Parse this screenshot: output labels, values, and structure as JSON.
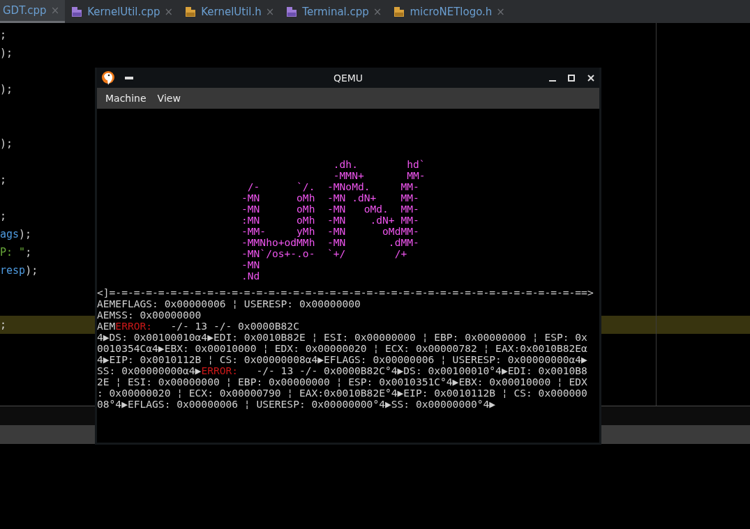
{
  "editor": {
    "tabs": [
      {
        "label": "GDT.cpp",
        "kind": "plain",
        "selected": true,
        "close": "×"
      },
      {
        "label": "KernelUtil.cpp",
        "kind": "cpp",
        "selected": false,
        "close": "×"
      },
      {
        "label": "KernelUtil.h",
        "kind": "h",
        "selected": false,
        "close": "×"
      },
      {
        "label": "Terminal.cpp",
        "kind": "cpp",
        "selected": false,
        "close": "×"
      },
      {
        "label": "microNETlogo.h",
        "kind": "h",
        "selected": false,
        "close": "×"
      }
    ],
    "code_lines": [
      {
        "kind": "code",
        "highlighted": false,
        "segments": [
          {
            "kind": "plain",
            "text": ";"
          }
        ]
      },
      {
        "kind": "code",
        "highlighted": false,
        "segments": [
          {
            "kind": "plain",
            "text": ");"
          }
        ]
      },
      {
        "kind": "blank",
        "highlighted": false
      },
      {
        "kind": "code",
        "highlighted": false,
        "segments": [
          {
            "kind": "plain",
            "text": ");"
          }
        ]
      },
      {
        "kind": "blank",
        "highlighted": false
      },
      {
        "kind": "blank",
        "highlighted": false
      },
      {
        "kind": "code",
        "highlighted": false,
        "segments": [
          {
            "kind": "plain",
            "text": ");"
          }
        ]
      },
      {
        "kind": "blank",
        "highlighted": false
      },
      {
        "kind": "code",
        "highlighted": false,
        "segments": [
          {
            "kind": "plain",
            "text": ";"
          }
        ]
      },
      {
        "kind": "blank",
        "highlighted": false
      },
      {
        "kind": "code",
        "highlighted": false,
        "segments": [
          {
            "kind": "plain",
            "text": ";"
          }
        ]
      },
      {
        "kind": "code",
        "highlighted": false,
        "segments": [
          {
            "kind": "identifier",
            "text": "ags"
          },
          {
            "kind": "plain",
            "text": ");"
          }
        ]
      },
      {
        "kind": "code",
        "highlighted": false,
        "segments": [
          {
            "kind": "string",
            "text": "P: \""
          },
          {
            "kind": "plain",
            "text": ";"
          }
        ]
      },
      {
        "kind": "code",
        "highlighted": false,
        "segments": [
          {
            "kind": "identifier",
            "text": "resp"
          },
          {
            "kind": "plain",
            "text": ");"
          }
        ]
      },
      {
        "kind": "blank",
        "highlighted": false
      },
      {
        "kind": "blank",
        "highlighted": false
      },
      {
        "kind": "code",
        "highlighted": true,
        "segments": [
          {
            "kind": "plain",
            "text": ";"
          }
        ]
      }
    ]
  },
  "window": {
    "title": "QEMU",
    "menu": [
      "Machine",
      "View"
    ],
    "ascii_art": [
      "               .dh.        hd`",
      "               -MMN+       MM-",
      " /-      `/.  -MNoMd.     MM-",
      "-MN      oMh  -MN .dN+    MM-",
      "-MN      oMh  -MN   oMd.  MM-",
      ":MN      oMh  -MN    .dN+ MM-",
      "-MM-     yMh  -MN      oMdMM-",
      "-MMNho+odMMh  -MN       .dMM-",
      "-MN`/os+-.o-  `+/        /+",
      "-MN",
      ".Nd"
    ],
    "console_lines": [
      [
        {
          "kind": "text",
          "text": "<]=-=-=-=-=-=-=-=-=-=-=-=-=-=-=-=-=-=-=-=-=-=-=-=-=-=-=-=-=-=-=-=-=-=-=-=-=-=-==>"
        }
      ],
      [
        {
          "kind": "text",
          "text": "AEMEFLAGS: 0x00000006 ¦ USERESP: 0x00000000"
        }
      ],
      [
        {
          "kind": "text",
          "text": "AEMSS: 0x00000000"
        }
      ],
      [
        {
          "kind": "text",
          "text": "AEM"
        },
        {
          "kind": "error",
          "text": "ERROR:"
        },
        {
          "kind": "text",
          "text": "   -/- 13 -/- 0x0000B82C"
        }
      ],
      [
        {
          "kind": "text",
          "text": "4▶DS: 0x00100010α4▶EDI: 0x0010B82E ¦ ESI: 0x00000000 ¦ EBP: 0x00000000 ¦ ESP: 0x"
        }
      ],
      [
        {
          "kind": "text",
          "text": "0010354Cα4▶EBX: 0x00010000 ¦ EDX: 0x00000020 ¦ ECX: 0x00000782 ¦ EAX:0x0010B82Eα"
        }
      ],
      [
        {
          "kind": "text",
          "text": "4▶EIP: 0x0010112B ¦ CS: 0x00000008α4▶EFLAGS: 0x00000006 ¦ USERESP: 0x00000000α4▶"
        }
      ],
      [
        {
          "kind": "text",
          "text": "SS: 0x00000000α4▶"
        },
        {
          "kind": "error",
          "text": "ERROR:"
        },
        {
          "kind": "text",
          "text": "   -/- 13 -/- 0x0000B82C°4▶DS: 0x00100010°4▶EDI: 0x0010B8"
        }
      ],
      [
        {
          "kind": "text",
          "text": "2E ¦ ESI: 0x00000000 ¦ EBP: 0x00000000 ¦ ESP: 0x0010351C°4▶EBX: 0x00010000 ¦ EDX"
        }
      ],
      [
        {
          "kind": "text",
          "text": ": 0x00000020 ¦ ECX: 0x00000790 ¦ EAX:0x0010B82E°4▶EIP: 0x0010112B ¦ CS: 0x000000"
        }
      ],
      [
        {
          "kind": "text",
          "text": "08°4▶EFLAGS: 0x00000006 ¦ USERESP: 0x00000000°4▶SS: 0x00000000°4▶"
        }
      ]
    ]
  }
}
